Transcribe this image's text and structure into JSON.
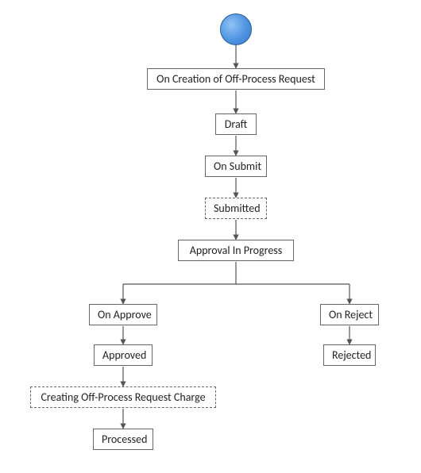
{
  "diagram": {
    "type": "flowchart",
    "nodes": {
      "start": {
        "kind": "start-circle"
      },
      "on_creation": {
        "label": "On Creation of Off-Process Request",
        "kind": "solid-box"
      },
      "draft": {
        "label": "Draft",
        "kind": "solid-box"
      },
      "on_submit": {
        "label": "On Submit",
        "kind": "solid-box"
      },
      "submitted": {
        "label": "Submitted",
        "kind": "dashed-box"
      },
      "approval": {
        "label": "Approval In Progress",
        "kind": "solid-box"
      },
      "on_approve": {
        "label": "On Approve",
        "kind": "solid-box"
      },
      "on_reject": {
        "label": "On Reject",
        "kind": "solid-box"
      },
      "approved": {
        "label": "Approved",
        "kind": "solid-box"
      },
      "rejected": {
        "label": "Rejected",
        "kind": "solid-box"
      },
      "creating": {
        "label": "Creating Off-Process Request Charge",
        "kind": "dashed-box"
      },
      "processed": {
        "label": "Processed",
        "kind": "solid-box"
      }
    },
    "edges": [
      [
        "start",
        "on_creation"
      ],
      [
        "on_creation",
        "draft"
      ],
      [
        "draft",
        "on_submit"
      ],
      [
        "on_submit",
        "submitted"
      ],
      [
        "submitted",
        "approval"
      ],
      [
        "approval",
        "branch"
      ],
      [
        "branch",
        "on_approve"
      ],
      [
        "branch",
        "on_reject"
      ],
      [
        "on_approve",
        "approved"
      ],
      [
        "on_reject",
        "rejected"
      ],
      [
        "approved",
        "creating"
      ],
      [
        "creating",
        "processed"
      ]
    ]
  }
}
